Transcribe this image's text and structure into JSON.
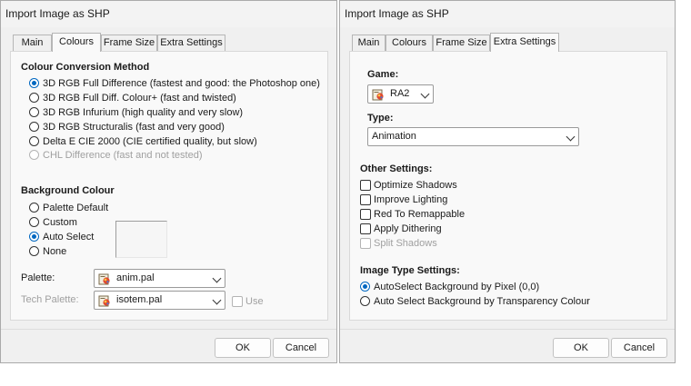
{
  "left": {
    "title": "Import Image as SHP",
    "tabs": [
      "Main",
      "Colours",
      "Frame Size",
      "Extra Settings"
    ],
    "active_tab": "Colours",
    "colour_conversion": {
      "heading": "Colour Conversion Method",
      "options": [
        {
          "label": "3D RGB Full Difference (fastest and good: the Photoshop one)",
          "selected": true,
          "enabled": true
        },
        {
          "label": "3D RGB Full Diff. Colour+ (fast and twisted)",
          "selected": false,
          "enabled": true
        },
        {
          "label": "3D RGB Infurium (high quality and very slow)",
          "selected": false,
          "enabled": true
        },
        {
          "label": "3D RGB Structuralis (fast and very good)",
          "selected": false,
          "enabled": true
        },
        {
          "label": "Delta E CIE 2000 (CIE certified quality, but slow)",
          "selected": false,
          "enabled": true
        },
        {
          "label": "CHL Difference (fast and not tested)",
          "selected": false,
          "enabled": false
        }
      ]
    },
    "background_colour": {
      "heading": "Background Colour",
      "options": [
        {
          "label": "Palette Default",
          "selected": false
        },
        {
          "label": "Custom",
          "selected": false
        },
        {
          "label": "Auto Select",
          "selected": true
        },
        {
          "label": "None",
          "selected": false
        }
      ]
    },
    "palette": {
      "label": "Palette:",
      "value": "anim.pal"
    },
    "tech_palette": {
      "label": "Tech Palette:",
      "value": "isotem.pal",
      "use_label": "Use",
      "use_checked": false
    },
    "ok_label": "OK",
    "cancel_label": "Cancel"
  },
  "right": {
    "title": "Import Image as SHP",
    "tabs": [
      "Main",
      "Colours",
      "Frame Size",
      "Extra Settings"
    ],
    "active_tab": "Extra Settings",
    "game": {
      "label": "Game:",
      "value": "RA2"
    },
    "type": {
      "label": "Type:",
      "value": "Animation"
    },
    "other_settings": {
      "heading": "Other Settings:",
      "options": [
        {
          "label": "Optimize Shadows",
          "checked": false,
          "enabled": true
        },
        {
          "label": "Improve Lighting",
          "checked": false,
          "enabled": true
        },
        {
          "label": "Red To Remappable",
          "checked": false,
          "enabled": true
        },
        {
          "label": "Apply Dithering",
          "checked": false,
          "enabled": true
        },
        {
          "label": "Split Shadows",
          "checked": false,
          "enabled": false
        }
      ]
    },
    "image_type": {
      "heading": "Image Type Settings:",
      "options": [
        {
          "label": "AutoSelect Background by Pixel (0,0)",
          "selected": true
        },
        {
          "label": "Auto Select Background by Transparency Colour",
          "selected": false
        }
      ]
    },
    "ok_label": "OK",
    "cancel_label": "Cancel"
  },
  "icons": {
    "palette_file": "palette-file-icon"
  },
  "colors": {
    "accent": "#0067c0",
    "window_bg": "#f0f0f0",
    "panel_bg": "#f9f9f9"
  }
}
